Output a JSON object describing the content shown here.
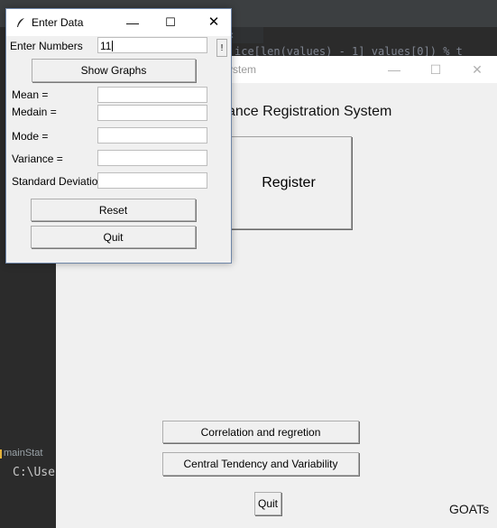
{
  "ide": {
    "tab_close": "×",
    "code_snippet": "  ice[len(values) - 1]   values[0]) % t",
    "terminal_tab": "mainStat",
    "terminal_line": "C:\\Use"
  },
  "main_window": {
    "title": "ystem",
    "controls": {
      "minimize": "—",
      "maximize": "☐",
      "close": "✕"
    },
    "heading": "ance Registration System",
    "register_label": "Register",
    "correlation_label": "Correlation and regretion",
    "central_tendency_label": "Central Tendency and Variability",
    "quit_label": "Quit",
    "footer_text": "GOATs"
  },
  "dialog": {
    "title": "Enter Data",
    "controls": {
      "minimize": "—",
      "maximize": "☐",
      "close": "✕"
    },
    "enter_numbers_label": "Enter Numbers",
    "enter_numbers_value": "11",
    "small_button_label": "!",
    "show_graphs_label": "Show Graphs",
    "mean_label": "Mean  =",
    "median_label": "Medain =",
    "mode_label": "Mode  =",
    "variance_label": "Variance  =",
    "std_label": "Standard Deviatio",
    "reset_label": "Reset",
    "quit_label": "Quit"
  }
}
